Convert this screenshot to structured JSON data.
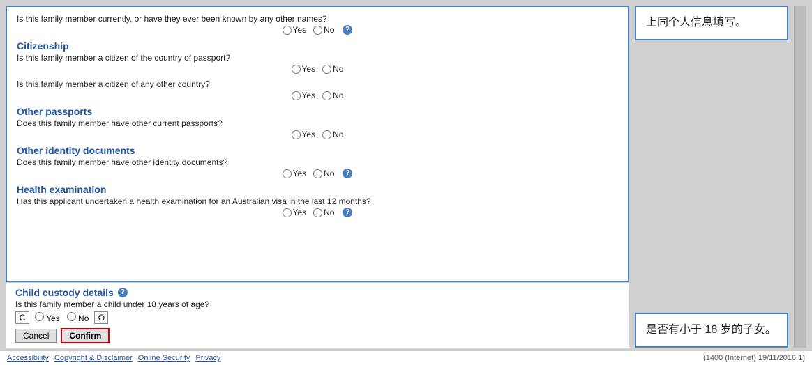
{
  "form": {
    "known_names_question": "Is this family member currently, or have they ever been known by any other names?",
    "citizenship_title": "Citizenship",
    "citizenship_q1": "Is this family member a citizen of the country of passport?",
    "citizenship_q2": "Is this family member a citizen of any other country?",
    "other_passports_title": "Other passports",
    "other_passports_q": "Does this family member have other current passports?",
    "other_identity_title": "Other identity documents",
    "other_identity_q": "Does this family member have other identity documents?",
    "health_title": "Health examination",
    "health_q": "Has this applicant undertaken a health examination for an Australian visa in the last 12 months?",
    "yes_label": "Yes",
    "no_label": "No",
    "help_icon": "?",
    "child_custody_title": "Child custody details",
    "child_custody_q": "Is this family member a child under 18 years of age?",
    "cancel_label": "Cancel",
    "confirm_label": "Confirm"
  },
  "annotations": {
    "top_right": "上同个人信息填写。",
    "bottom_right": "是否有小于 18 岁的子女。"
  },
  "footer": {
    "accessibility": "Accessibility",
    "copyright": "Copyright & Disclaimer",
    "online_security": "Online Security",
    "privacy": "Privacy",
    "version": "(1400 (Internet) 19/11/2016.1)"
  }
}
